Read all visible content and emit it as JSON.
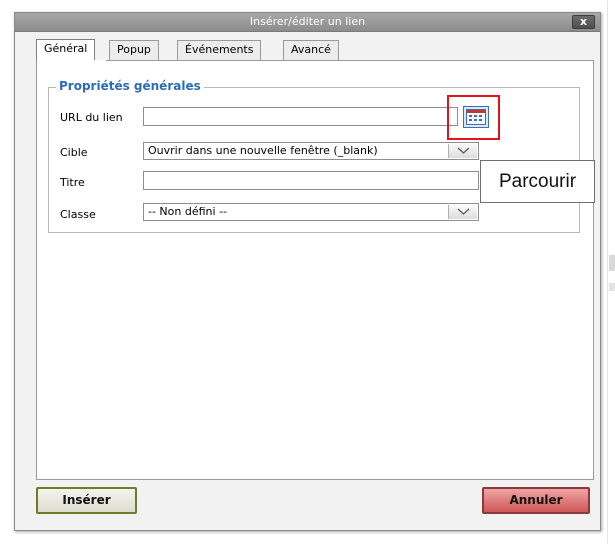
{
  "dialog": {
    "title": "Insérer/éditer un lien",
    "close_symbol": "x"
  },
  "tabs": [
    {
      "label": "Général",
      "active": true
    },
    {
      "label": "Popup",
      "active": false
    },
    {
      "label": "Événements",
      "active": false
    },
    {
      "label": "Avancé",
      "active": false
    }
  ],
  "general": {
    "legend": "Propriétés générales",
    "fields": {
      "url": {
        "label": "URL du lien",
        "value": ""
      },
      "target": {
        "label": "Cible",
        "value": "Ouvrir dans une nouvelle fenêtre (_blank)"
      },
      "title": {
        "label": "Titre",
        "value": ""
      },
      "class": {
        "label": "Classe",
        "value": "-- Non défini --"
      }
    },
    "browse_icon": "browse-icon",
    "tooltip": "Parcourir"
  },
  "footer": {
    "insert_label": "Insérer",
    "cancel_label": "Annuler"
  },
  "colors": {
    "legend_blue": "#2b6db5",
    "highlight_red": "#e3151a",
    "insert_border": "#6c7d2a",
    "cancel_fill": "#d05757"
  }
}
